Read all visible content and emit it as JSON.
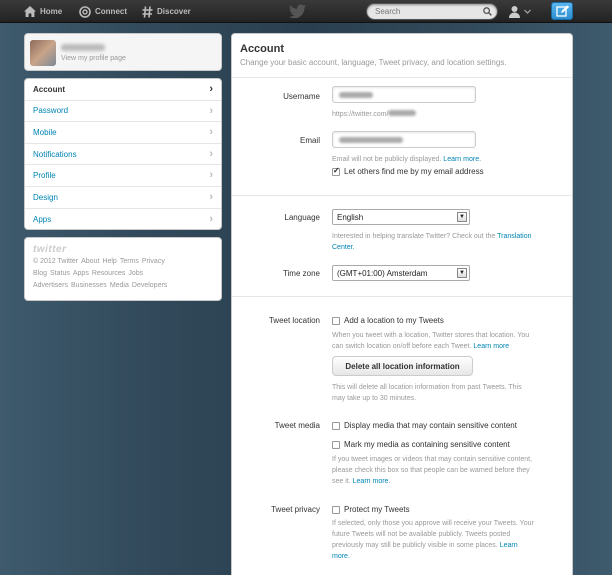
{
  "topbar": {
    "nav": [
      {
        "label": "Home",
        "icon": "home-icon"
      },
      {
        "label": "Connect",
        "icon": "at-icon"
      },
      {
        "label": "Discover",
        "icon": "hash-icon"
      }
    ],
    "search_placeholder": "Search"
  },
  "profile": {
    "link": "View my profile page"
  },
  "sidebar": {
    "items": [
      {
        "label": "Account"
      },
      {
        "label": "Password"
      },
      {
        "label": "Mobile"
      },
      {
        "label": "Notifications"
      },
      {
        "label": "Profile"
      },
      {
        "label": "Design"
      },
      {
        "label": "Apps"
      }
    ]
  },
  "footer": {
    "logo": "twitter",
    "links": [
      "© 2012 Twitter",
      "About",
      "Help",
      "Terms",
      "Privacy",
      "Blog",
      "Status",
      "Apps",
      "Resources",
      "Jobs",
      "Advertisers",
      "Businesses",
      "Media",
      "Developers"
    ]
  },
  "main": {
    "title": "Account",
    "subtitle": "Change your basic account, language, Tweet privacy, and location settings.",
    "username": {
      "label": "Username",
      "url_prefix": "https://twitter.com/"
    },
    "email": {
      "label": "Email",
      "help": "Email will not be publicly displayed.",
      "help_link": "Learn more.",
      "find_me": "Let others find me by my email address"
    },
    "language": {
      "label": "Language",
      "value": "English",
      "help": "Interested in helping translate Twitter? Check out the",
      "help_link_1": "Translation",
      "help_link_2": "Center."
    },
    "timezone": {
      "label": "Time zone",
      "value": "(GMT+01:00) Amsterdam"
    },
    "tweet_location": {
      "label": "Tweet location",
      "checkbox": "Add a location to my Tweets",
      "help_1": "When you tweet with a location, Twitter stores that location. You",
      "help_2": "can switch location on/off before each Tweet.",
      "help_link": "Learn more",
      "button": "Delete all location information",
      "delete_help_1": "This will delete all location information from past Tweets. This",
      "delete_help_2": "may take up to 30 minutes."
    },
    "tweet_media": {
      "label": "Tweet media",
      "checkbox_1": "Display media that may contain sensitive content",
      "checkbox_2": "Mark my media as containing sensitive content",
      "help_1": "If you tweet images or videos that may contain sensitive content,",
      "help_2": "please check this box so that people can be warned before they",
      "help_3": "see it.",
      "help_link": "Learn more."
    },
    "tweet_privacy": {
      "label": "Tweet privacy",
      "checkbox": "Protect my Tweets",
      "help_1": "If selected, only those you approve will receive your Tweets. Your",
      "help_2": "future Tweets will not be available publicly. Tweets posted",
      "help_3": "previously may still be publicly visible in some places.",
      "help_link_1": "Learn",
      "help_link_2": "more."
    }
  }
}
